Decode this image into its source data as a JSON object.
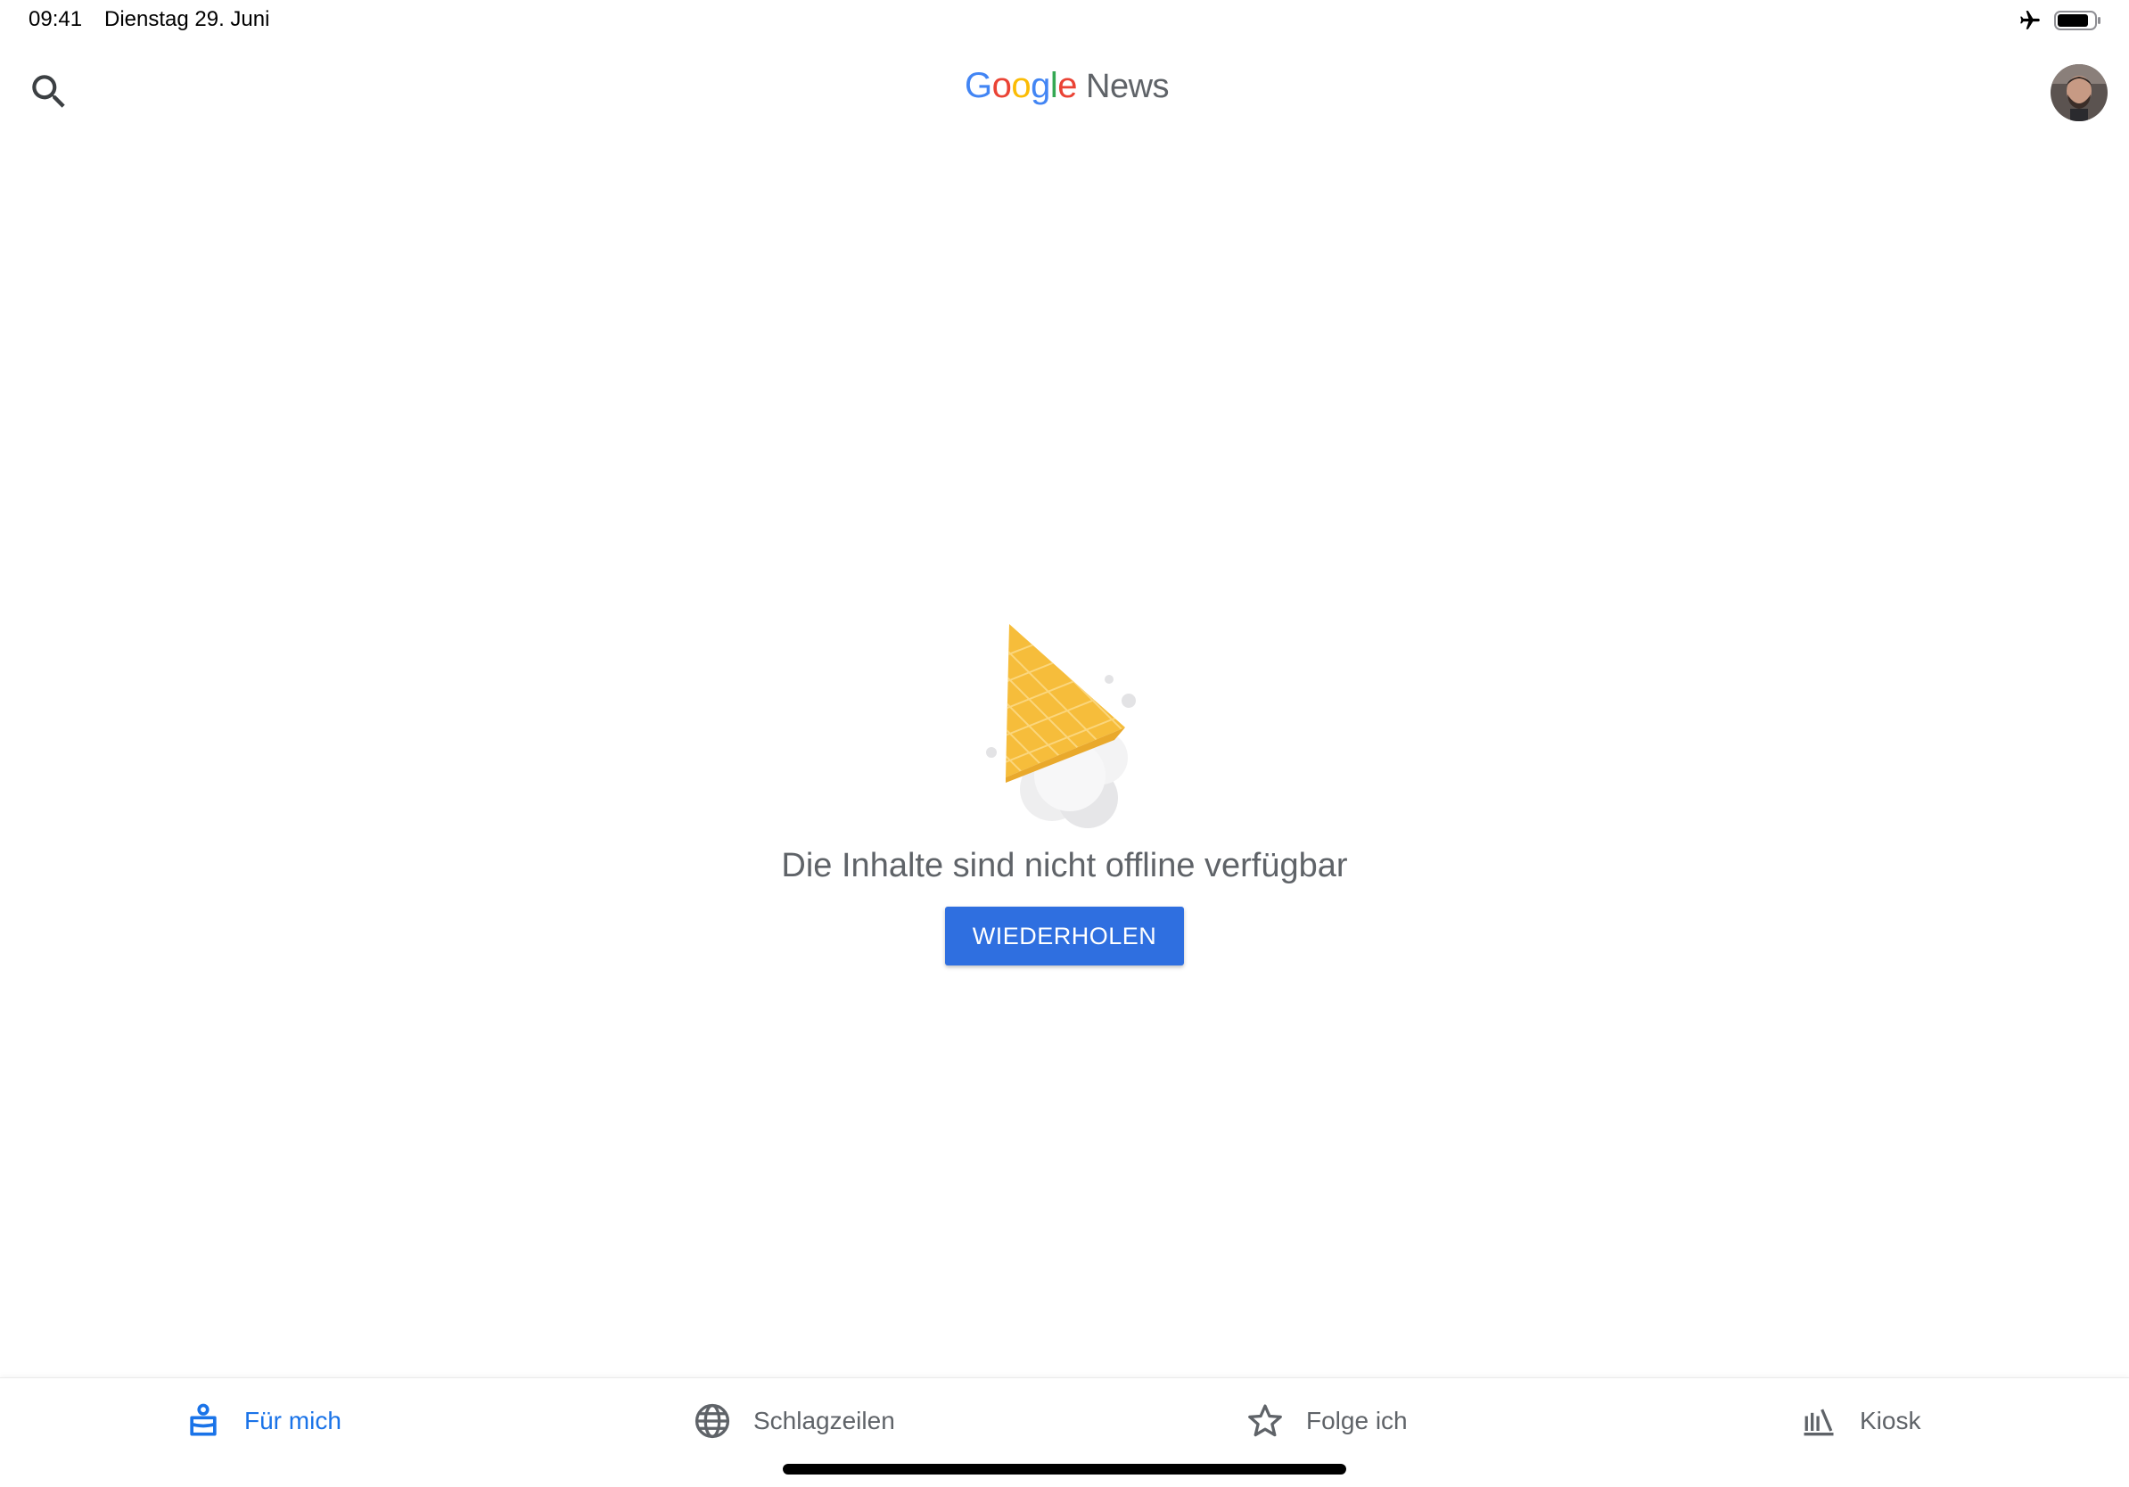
{
  "status_bar": {
    "time": "09:41",
    "date": "Dienstag 29. Juni",
    "icons": [
      "airplane-mode-icon",
      "battery-icon"
    ]
  },
  "header": {
    "logo": {
      "google_letters": [
        "G",
        "o",
        "o",
        "g",
        "l",
        "e"
      ],
      "product": "News"
    },
    "search_icon": "search-icon",
    "avatar": "user-avatar"
  },
  "empty_state": {
    "illustration": "dropped-ice-cream-cone",
    "message": "Die Inhalte sind nicht offline verfügbar",
    "retry_label": "WIEDERHOLEN"
  },
  "bottom_nav": {
    "items": [
      {
        "label": "Für mich",
        "icon": "for-you-icon",
        "active": true
      },
      {
        "label": "Schlagzeilen",
        "icon": "globe-icon",
        "active": false
      },
      {
        "label": "Folge ich",
        "icon": "star-icon",
        "active": false
      },
      {
        "label": "Kiosk",
        "icon": "newsstand-icon",
        "active": false
      }
    ]
  },
  "colors": {
    "accent": "#1a73e8",
    "button": "#2f6fe0",
    "text_secondary": "#5f6368",
    "cone": "#f6bd3b"
  }
}
